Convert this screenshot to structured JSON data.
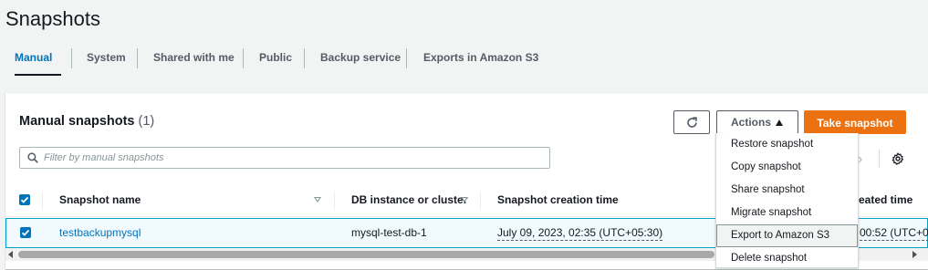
{
  "page": {
    "title": "Snapshots"
  },
  "tabs": [
    {
      "label": "Manual",
      "active": true
    },
    {
      "label": "System"
    },
    {
      "label": "Shared with me"
    },
    {
      "label": "Public"
    },
    {
      "label": "Backup service"
    },
    {
      "label": "Exports in Amazon S3"
    }
  ],
  "panel": {
    "title": "Manual snapshots",
    "count": "(1)",
    "actions_label": "Actions",
    "take_snapshot_label": "Take snapshot",
    "filter_placeholder": "Filter by manual snapshots"
  },
  "table": {
    "columns": [
      "Snapshot name",
      "DB instance or cluster",
      "Snapshot creation time",
      "eated time"
    ],
    "rows": [
      {
        "selected": true,
        "name": "testbackupmysql",
        "db_instance": "mysql-test-db-1",
        "creation_time": "July 09, 2023, 02:35 (UTC+05:30)",
        "created_time_partial": "00:52 (UTC+0"
      }
    ]
  },
  "actions_menu": [
    "Restore snapshot",
    "Copy snapshot",
    "Share snapshot",
    "Migrate snapshot",
    "Export to Amazon S3",
    "Delete snapshot"
  ],
  "colors": {
    "accent": "#0073bb",
    "primary_button": "#ec7211",
    "selected_row_bg": "#f1faff",
    "selected_row_border": "#00a1c9"
  },
  "icons": [
    "refresh-icon",
    "caret-up-icon",
    "search-icon",
    "chevron-right-icon",
    "gear-icon",
    "sort-icon",
    "checkbox-checked-icon"
  ]
}
